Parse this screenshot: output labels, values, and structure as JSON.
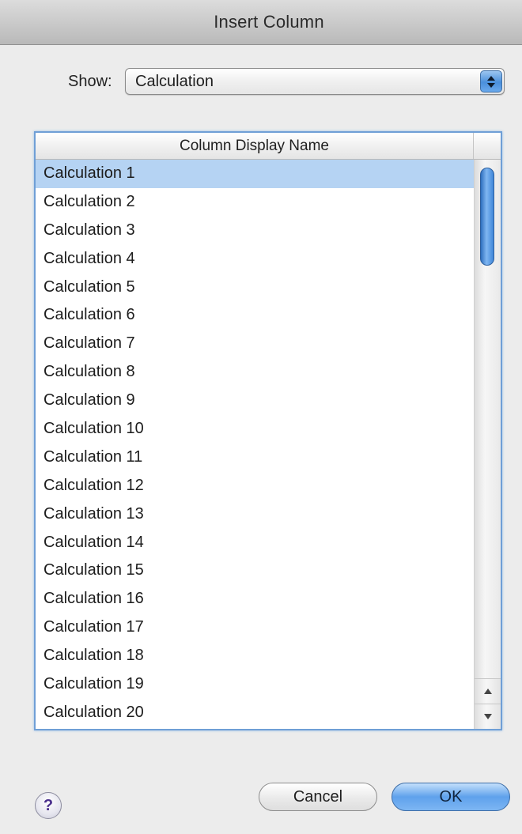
{
  "dialog": {
    "title": "Insert Column"
  },
  "show": {
    "label": "Show:",
    "selected": "Calculation"
  },
  "table": {
    "column_header": "Column Display Name",
    "selected_index": 0,
    "rows": [
      "Calculation 1",
      "Calculation 2",
      "Calculation 3",
      "Calculation 4",
      "Calculation 5",
      "Calculation 6",
      "Calculation 7",
      "Calculation 8",
      "Calculation 9",
      "Calculation 10",
      "Calculation 11",
      "Calculation 12",
      "Calculation 13",
      "Calculation 14",
      "Calculation 15",
      "Calculation 16",
      "Calculation 17",
      "Calculation 18",
      "Calculation 19",
      "Calculation 20"
    ]
  },
  "buttons": {
    "help": "?",
    "cancel": "Cancel",
    "ok": "OK"
  },
  "colors": {
    "selection": "#b5d3f3",
    "focus_ring": "#6f9fd6",
    "accent": "#4a8fdc"
  }
}
